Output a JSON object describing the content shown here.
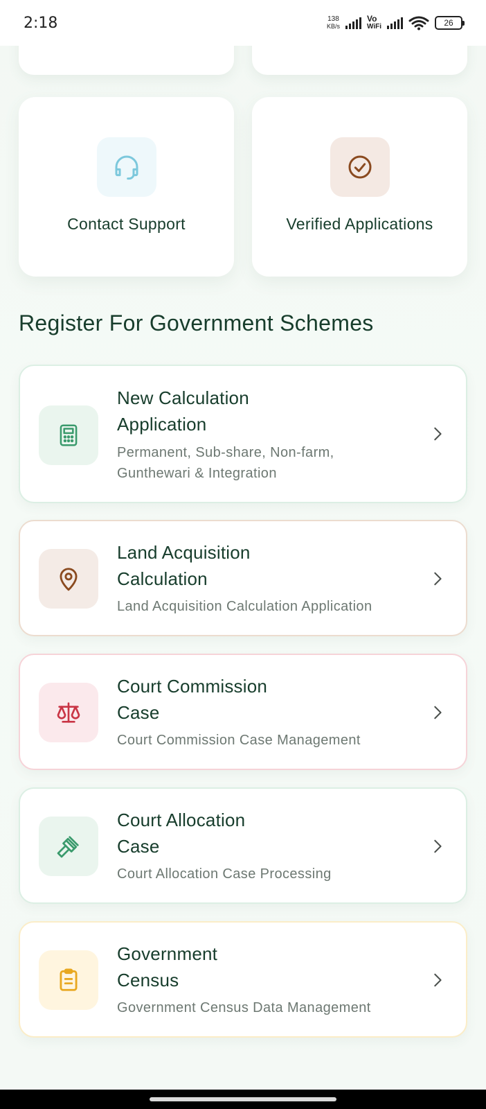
{
  "status_bar": {
    "time": "2:18",
    "net_speed_value": "138",
    "net_speed_unit": "KB/s",
    "vo_top": "Vo",
    "vo_bottom": "WiFi",
    "battery": "26"
  },
  "feature_cards": [
    {
      "label": "Contact Support",
      "icon": "headset-icon",
      "icon_bg": "#eef8fb",
      "icon_color": "#7cc8dc"
    },
    {
      "label": "Verified Applications",
      "icon": "check-circle-icon",
      "icon_bg": "#f4e9e3",
      "icon_color": "#8a4a1f"
    }
  ],
  "section_title": "Register For Government Schemes",
  "schemes": [
    {
      "title_line1": "New Calculation",
      "title_line2": "Application",
      "desc_line1": "Permanent, Sub-share, Non-farm,",
      "desc_line2": "Gunthewari & Integration",
      "icon": "calculator-icon",
      "icon_bg": "#eaf5ee",
      "icon_color": "#3a9a6c",
      "border": "#dcefe4"
    },
    {
      "title_line1": "Land Acquisition",
      "title_line2": "Calculation",
      "desc_line1": "Land Acquisition Calculation Application",
      "icon": "map-pin-icon",
      "icon_bg": "#f4ebe6",
      "icon_color": "#8a4a1f",
      "border": "#ecdccf"
    },
    {
      "title_line1": "Court Commission",
      "title_line2": "Case",
      "desc_line1": "Court Commission Case Management",
      "icon": "scales-icon",
      "icon_bg": "#fbe9ec",
      "icon_color": "#c93545",
      "border": "#f6d3d8"
    },
    {
      "title_line1": "Court Allocation",
      "title_line2": "Case",
      "desc_line1": "Court Allocation Case Processing",
      "icon": "gavel-icon",
      "icon_bg": "#eaf5ee",
      "icon_color": "#3a9a6c",
      "border": "#dcefe4"
    },
    {
      "title_line1": "Government",
      "title_line2": "Census",
      "desc_line1": "Government Census Data Management",
      "icon": "clipboard-icon",
      "icon_bg": "#fff5df",
      "icon_color": "#e8a820",
      "border": "#fbedc8"
    }
  ]
}
